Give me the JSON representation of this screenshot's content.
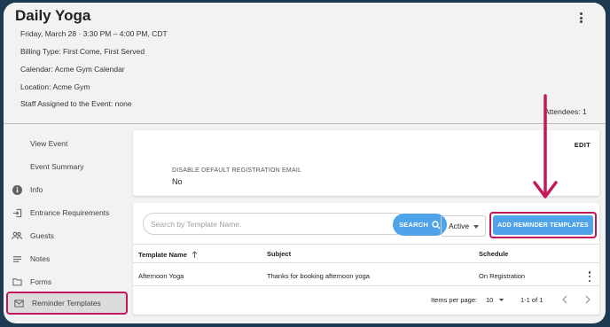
{
  "event": {
    "title": "Daily Yoga",
    "date_line": "Friday, March 28  ·  3:30 PM – 4:00 PM, CDT",
    "billing": "Billing Type: First Come, First Served",
    "calendar": "Calendar: Acme Gym Calendar",
    "location": "Location: Acme Gym",
    "staff": "Staff Assigned to the Event: none",
    "attendees": "Attendees: 1"
  },
  "sidebar": {
    "items": [
      {
        "label": "View Event",
        "icon": "none"
      },
      {
        "label": "Event Summary",
        "icon": "none"
      },
      {
        "label": "Info",
        "icon": "info-icon"
      },
      {
        "label": "Entrance Requirements",
        "icon": "login-icon"
      },
      {
        "label": "Guests",
        "icon": "people-icon"
      },
      {
        "label": "Notes",
        "icon": "notes-icon"
      },
      {
        "label": "Forms",
        "icon": "folder-icon"
      },
      {
        "label": "Reminder Templates",
        "icon": "mail-icon"
      }
    ],
    "active": "Reminder Templates"
  },
  "registration": {
    "edit_label": "EDIT",
    "label": "DISABLE DEFAULT REGISTRATION EMAIL",
    "value": "No"
  },
  "templates": {
    "search_placeholder": "Search by Template Name.",
    "search_label": "SEARCH",
    "status_value": "Active",
    "add_label": "ADD REMINDER TEMPLATES",
    "columns": [
      "Template Name",
      "Subject",
      "Schedule"
    ],
    "rows": [
      {
        "name": "Afternoon Yoga",
        "subject": "Thanks for booking afternoon yoga",
        "schedule": "On Registration"
      }
    ],
    "items_per_page_label": "Items per page:",
    "items_per_page": "10",
    "range": "1-1 of 1"
  },
  "colors": {
    "accent": "#4fa3e8",
    "highlight": "#c2185b",
    "frame": "#1d3a52"
  }
}
